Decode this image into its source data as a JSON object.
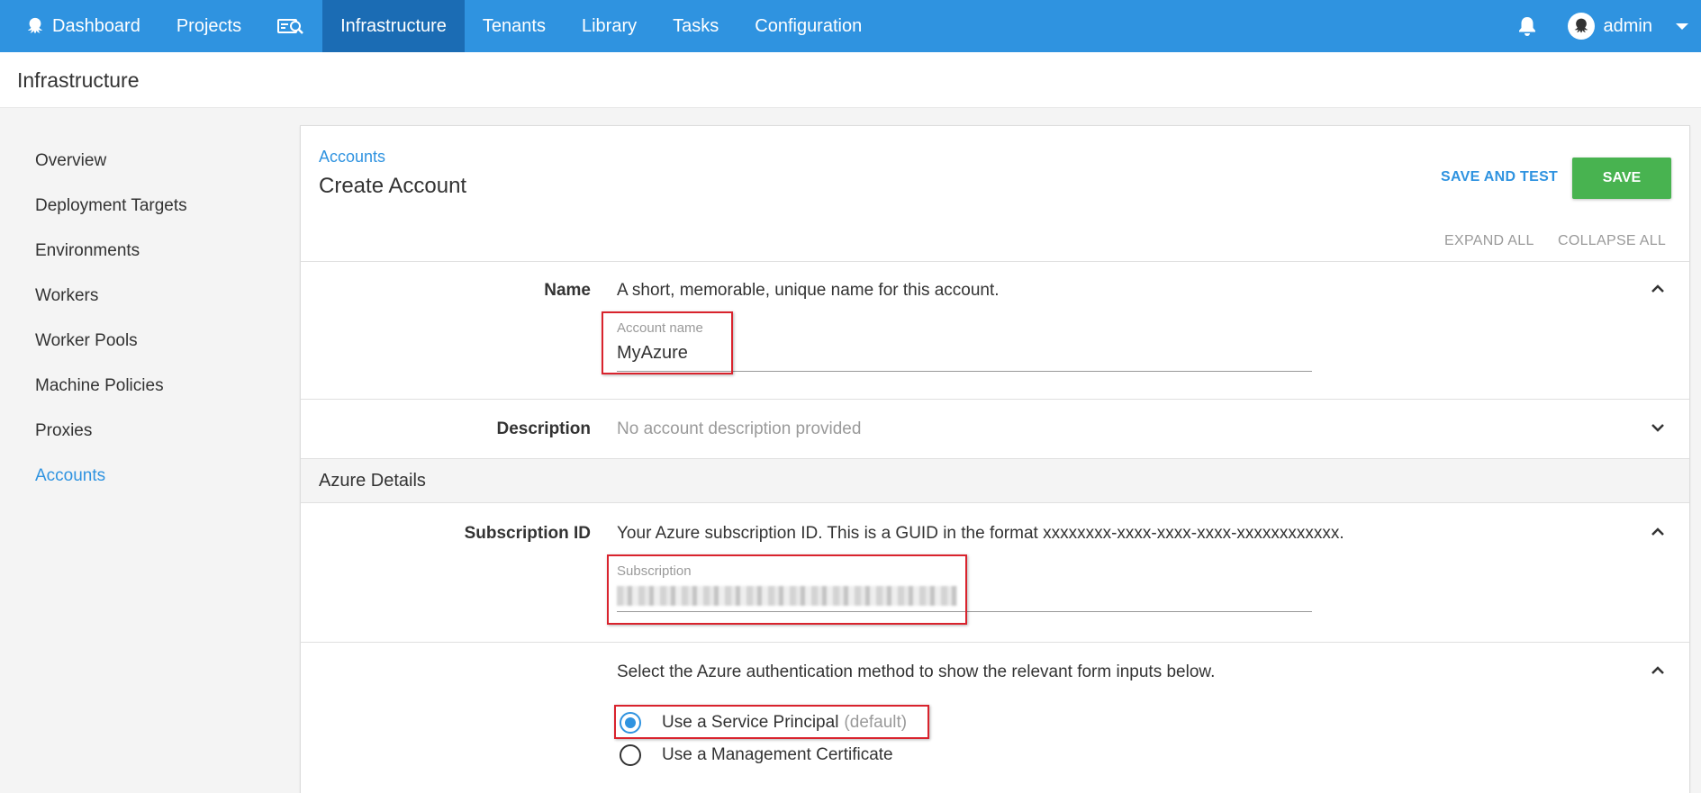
{
  "nav": {
    "items": [
      {
        "label": "Dashboard",
        "icon": "octopus-logo-icon"
      },
      {
        "label": "Projects"
      },
      {
        "label": "",
        "icon": "search-server-icon"
      },
      {
        "label": "Infrastructure",
        "active": true
      },
      {
        "label": "Tenants"
      },
      {
        "label": "Library"
      },
      {
        "label": "Tasks"
      },
      {
        "label": "Configuration"
      }
    ],
    "user": "admin",
    "accent": "#2f93e0",
    "active_bg": "#1b6cb4"
  },
  "page": {
    "title": "Infrastructure"
  },
  "sidebar": {
    "items": [
      {
        "label": "Overview"
      },
      {
        "label": "Deployment Targets"
      },
      {
        "label": "Environments"
      },
      {
        "label": "Workers"
      },
      {
        "label": "Worker Pools"
      },
      {
        "label": "Machine Policies"
      },
      {
        "label": "Proxies"
      },
      {
        "label": "Accounts",
        "active": true
      }
    ]
  },
  "card": {
    "breadcrumb": "Accounts",
    "title": "Create Account",
    "save_and_test": "SAVE AND TEST",
    "save": "SAVE",
    "expand_all": "EXPAND ALL",
    "collapse_all": "COLLAPSE ALL",
    "save_color": "#48b350"
  },
  "form": {
    "name": {
      "label": "Name",
      "help": "A short, memorable, unique name for this account.",
      "field_label": "Account name",
      "value": "MyAzure"
    },
    "description": {
      "label": "Description",
      "help": "No account description provided"
    },
    "section": "Azure Details",
    "subscription": {
      "label": "Subscription ID",
      "help": "Your Azure subscription ID. This is a GUID in the format xxxxxxxx-xxxx-xxxx-xxxx-xxxxxxxxxxxx.",
      "field_label": "Subscription"
    },
    "auth": {
      "help": "Select the Azure authentication method to show the relevant form inputs below.",
      "options": [
        {
          "label": "Use a Service Principal",
          "suffix": "(default)",
          "selected": true
        },
        {
          "label": "Use a Management Certificate",
          "selected": false
        }
      ]
    }
  }
}
